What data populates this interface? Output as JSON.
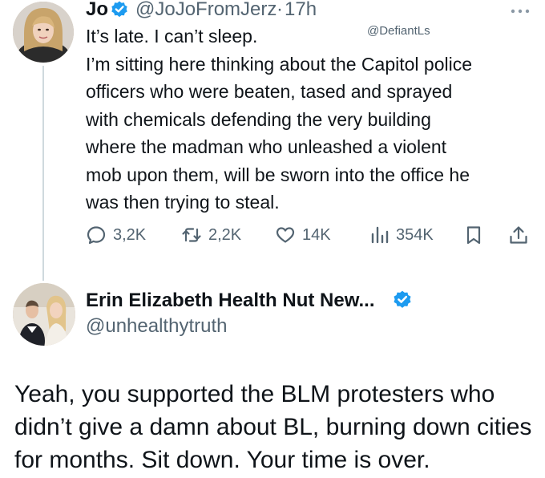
{
  "tweet": {
    "author_name": "Jo",
    "author_handle": "@JoJoFromJerz",
    "separator": "·",
    "time": "17h",
    "watermark": "@DefiantLs",
    "lines": [
      "It’s late. I can’t sleep.",
      "I’m sitting here thinking about the Capitol police",
      "officers who were beaten, tased and sprayed",
      "with chemicals defending the very building",
      "where the madman who unleashed a violent",
      "mob upon them, will be sworn into the office he",
      "was then trying to steal."
    ],
    "actions": {
      "replies": "3,2K",
      "reposts": "2,2K",
      "likes": "14K",
      "views": "354K"
    }
  },
  "reply": {
    "author_name": "Erin Elizabeth Health Nut New...",
    "author_handle": "@unhealthytruth",
    "lines": [
      "Yeah, you supported the BLM protesters who",
      "didn’t give a damn about BL, burning down cities",
      "for months. Sit down. Your time is over."
    ]
  },
  "colors": {
    "verified": "#1d9bf0",
    "text": "#0f1419",
    "secondary": "#536471"
  },
  "icons": [
    "verified-badge-icon",
    "more-icon",
    "reply-icon",
    "repost-icon",
    "like-icon",
    "views-icon",
    "bookmark-icon",
    "share-icon"
  ]
}
